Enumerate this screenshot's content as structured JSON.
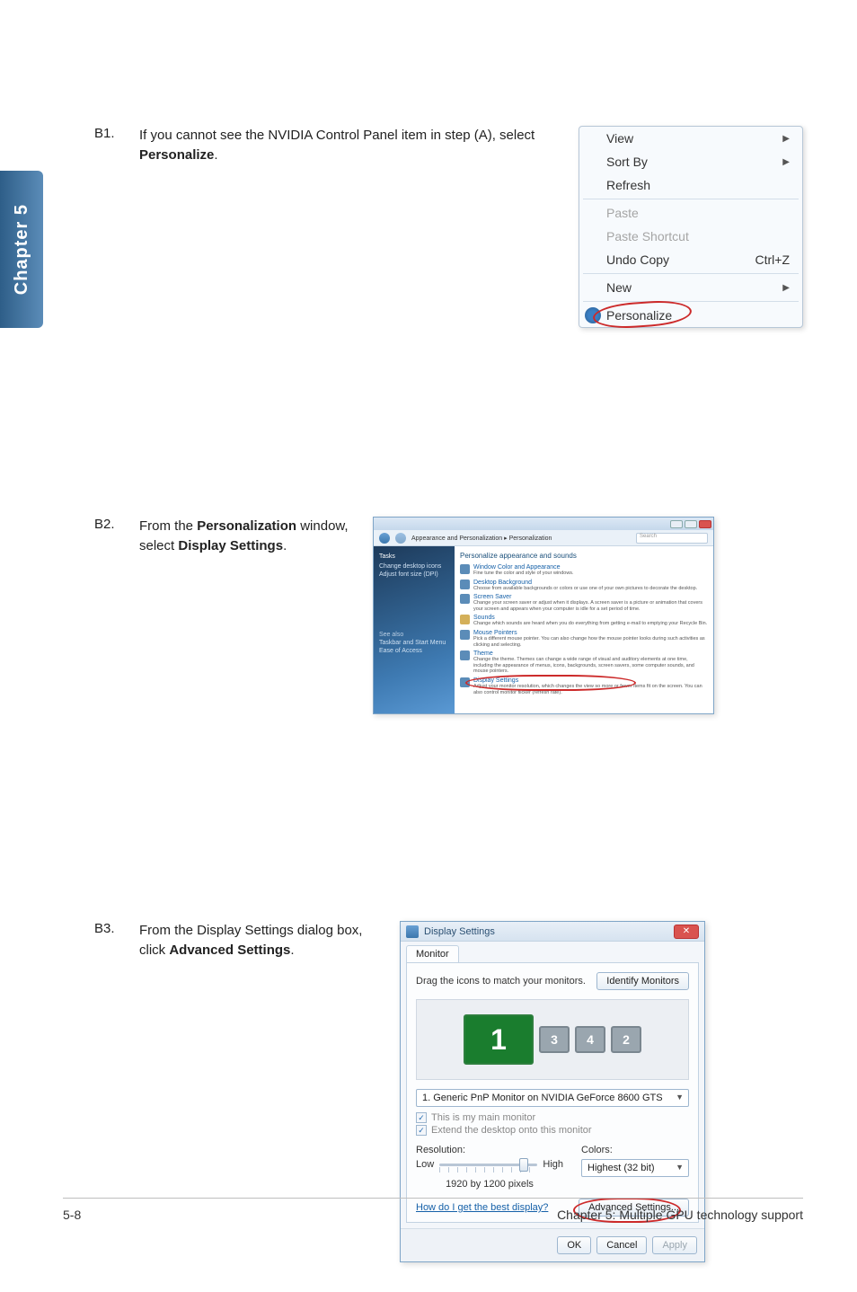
{
  "sideTab": "Chapter 5",
  "footer": {
    "left": "5-8",
    "right": "Chapter 5: Multiple GPU technology support"
  },
  "steps": {
    "b1": {
      "num": "B1.",
      "text_pre": "If you cannot see the NVIDIA Control Panel item in step (A), select ",
      "bold": "Personalize",
      "text_post": "."
    },
    "b2": {
      "num": "B2.",
      "text_pre": "From the ",
      "bold1": "Personalization",
      "text_mid": " window, select ",
      "bold2": "Display Settings",
      "text_post": "."
    },
    "b3": {
      "num": "B3.",
      "text_pre": "From the Display Settings dialog box, click ",
      "bold": "Advanced Settings",
      "text_post": "."
    }
  },
  "ctxMenu": {
    "view": "View",
    "sortby": "Sort By",
    "refresh": "Refresh",
    "paste": "Paste",
    "pasteShortcut": "Paste Shortcut",
    "undoCopy": "Undo Copy",
    "undoCopySc": "Ctrl+Z",
    "new": "New",
    "personalize": "Personalize"
  },
  "persWin": {
    "crumb": "Appearance and Personalization ▸ Personalization",
    "searchPh": "Search",
    "side": {
      "tasksHd": "Tasks",
      "task1": "Change desktop icons",
      "task2": "Adjust font size (DPI)",
      "seeAlso": "See also",
      "sa1": "Taskbar and Start Menu",
      "sa2": "Ease of Access"
    },
    "mainHd": "Personalize appearance and sounds",
    "items": [
      {
        "title": "Window Color and Appearance",
        "desc": "Fine tune the color and style of your windows."
      },
      {
        "title": "Desktop Background",
        "desc": "Choose from available backgrounds or colors or use one of your own pictures to decorate the desktop."
      },
      {
        "title": "Screen Saver",
        "desc": "Change your screen saver or adjust when it displays. A screen saver is a picture or animation that covers your screen and appears when your computer is idle for a set period of time."
      },
      {
        "title": "Sounds",
        "desc": "Change which sounds are heard when you do everything from getting e-mail to emptying your Recycle Bin."
      },
      {
        "title": "Mouse Pointers",
        "desc": "Pick a different mouse pointer. You can also change how the mouse pointer looks during such activities as clicking and selecting."
      },
      {
        "title": "Theme",
        "desc": "Change the theme. Themes can change a wide range of visual and auditory elements at one time, including the appearance of menus, icons, backgrounds, screen savers, some computer sounds, and mouse pointers."
      },
      {
        "title": "Display Settings",
        "desc": "Adjust your monitor resolution, which changes the view so more or fewer items fit on the screen. You can also control monitor flicker (refresh rate)."
      }
    ]
  },
  "dispWin": {
    "title": "Display Settings",
    "tab": "Monitor",
    "dragLabel": "Drag the icons to match your monitors.",
    "identify": "Identify Monitors",
    "monitors": {
      "m1": "1",
      "m3": "3",
      "m4": "4",
      "m2": "2"
    },
    "selectLabel": "1. Generic PnP Monitor on NVIDIA GeForce 8600 GTS",
    "chkMain": "This is my main monitor",
    "chkExtend": "Extend the desktop onto this monitor",
    "resLabel": "Resolution:",
    "resLow": "Low",
    "resHigh": "High",
    "resValue": "1920 by 1200 pixels",
    "colorsLabel": "Colors:",
    "colorsValue": "Highest (32 bit)",
    "helpLink": "How do I get the best display?",
    "advBtn": "Advanced Settings...",
    "ok": "OK",
    "cancel": "Cancel",
    "apply": "Apply"
  }
}
